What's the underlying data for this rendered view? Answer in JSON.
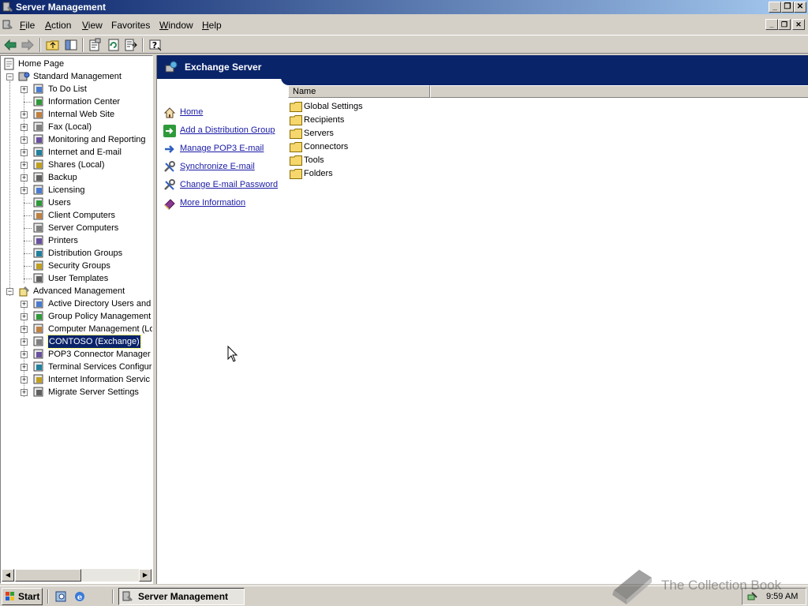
{
  "window": {
    "title": "Server Management",
    "minimize_glyph": "_",
    "maximize_glyph": "❐",
    "close_glyph": "✕"
  },
  "menu": [
    {
      "label": "File",
      "accel": "F",
      "rest": "ile"
    },
    {
      "label": "Action",
      "accel": "A",
      "rest": "ction"
    },
    {
      "label": "View",
      "accel": "V",
      "rest": "iew"
    },
    {
      "label": "Favorites",
      "accel": "",
      "rest": "Favorites"
    },
    {
      "label": "Window",
      "accel": "W",
      "rest": "indow"
    },
    {
      "label": "Help",
      "accel": "H",
      "rest": "elp"
    }
  ],
  "toolbar": {
    "icons": [
      "back-arrow-icon",
      "forward-arrow-icon",
      "up-folder-icon",
      "show-hide-tree-icon",
      "properties-icon",
      "refresh-icon",
      "export-list-icon",
      "help-icon"
    ]
  },
  "tree": {
    "home": "Home Page",
    "standard": {
      "label": "Standard Management",
      "items": [
        "To Do List",
        "Information Center",
        "Internal Web Site",
        "Fax (Local)",
        "Monitoring and Reporting",
        "Internet and E-mail",
        "Shares (Local)",
        "Backup",
        "Licensing",
        "Users",
        "Client Computers",
        "Server Computers",
        "Printers",
        "Distribution Groups",
        "Security Groups",
        "User Templates"
      ]
    },
    "advanced": {
      "label": "Advanced Management",
      "items": [
        "Active Directory Users and",
        "Group Policy Management",
        "Computer Management (Lo",
        "CONTOSO (Exchange)",
        "POP3 Connector Manager",
        "Terminal Services Configura",
        "Internet Information Servic",
        "Migrate Server Settings"
      ]
    },
    "scroll_left": "◀",
    "scroll_right": "▶"
  },
  "panel": {
    "title": "Exchange Server",
    "tasks": [
      "Home",
      "Add a Distribution Group",
      "Manage POP3 E-mail",
      "Synchronize E-mail",
      "Change E-mail Password",
      "More Information"
    ],
    "list_header": "Name",
    "list_items": [
      "Global Settings",
      "Recipients",
      "Servers",
      "Connectors",
      "Tools",
      "Folders"
    ]
  },
  "taskbar": {
    "start": "Start",
    "window_button": "Server Management",
    "clock": "9:59 AM"
  },
  "watermark": "The Collection Book",
  "colors": {
    "accent": "#0a246a",
    "link": "#1a1aa6",
    "face": "#d4d0c8"
  }
}
